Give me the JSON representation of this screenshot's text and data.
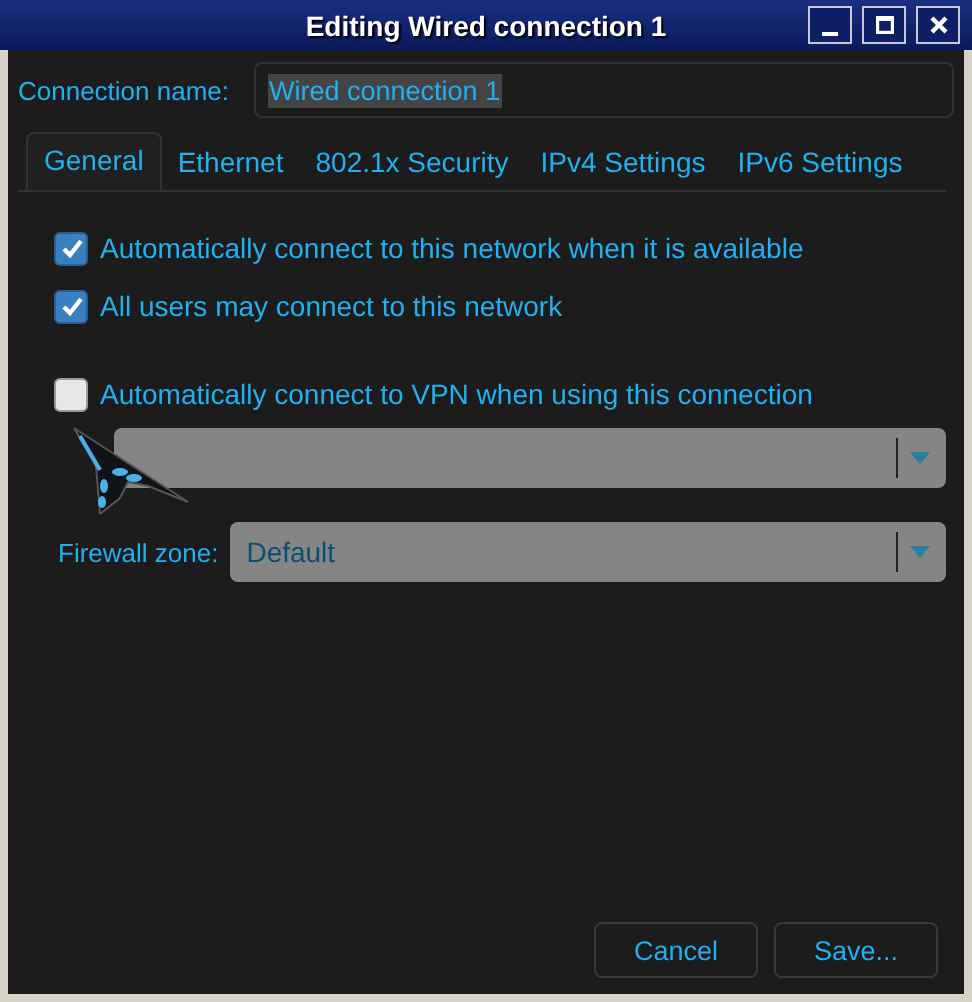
{
  "window": {
    "title": "Editing Wired connection 1"
  },
  "connection_name": {
    "label": "Connection name:",
    "value": "Wired connection 1",
    "text_selected": true
  },
  "tabs": [
    {
      "label": "General",
      "selected": true
    },
    {
      "label": "Ethernet",
      "selected": false
    },
    {
      "label": "802.1x Security",
      "selected": false
    },
    {
      "label": "IPv4 Settings",
      "selected": false
    },
    {
      "label": "IPv6 Settings",
      "selected": false
    }
  ],
  "options": [
    {
      "label": "Automatically connect to this network when it is available",
      "checked": true
    },
    {
      "label": "All users may connect to this network",
      "checked": true
    },
    {
      "label": "Automatically connect to VPN when using this connection",
      "checked": false
    }
  ],
  "vpn_combo": {
    "disabled": true
  },
  "firewall_zone": {
    "label": "Firewall zone:",
    "value": "Default",
    "disabled": true
  },
  "buttons": [
    "Cancel",
    "Save..."
  ]
}
